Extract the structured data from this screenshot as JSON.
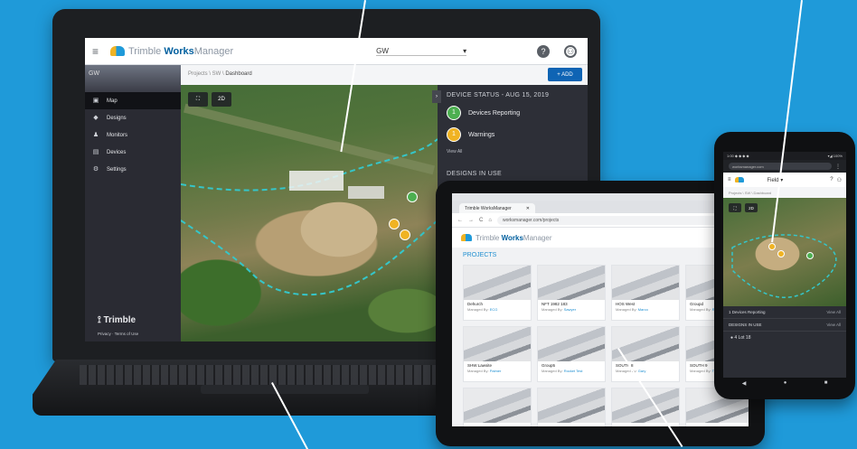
{
  "laptop": {
    "topbar": {
      "logo_prefix": "Trimble ",
      "logo_bold": "Works",
      "logo_suffix": "Manager",
      "site_select": "GW",
      "select_caret": "▾",
      "help_icon": "?",
      "user_icon": "⚇"
    },
    "subbar": {
      "prefix": "Projects \\ SW \\ ",
      "current": "Dashboard",
      "add_button": "+ ADD"
    },
    "sidebar": {
      "site": "GW",
      "items": [
        {
          "icon": "▣",
          "label": "Map",
          "active": true
        },
        {
          "icon": "◆",
          "label": "Designs"
        },
        {
          "icon": "♟",
          "label": "Monitors"
        },
        {
          "icon": "▤",
          "label": "Devices"
        },
        {
          "icon": "⚙",
          "label": "Settings"
        }
      ],
      "brand": "⟟ Trimble",
      "legal": "Privacy · Terms of Use"
    },
    "map": {
      "fit_icon": "⛶",
      "mode_2d": "2D",
      "markers": [
        {
          "color": "#4caf50"
        },
        {
          "color": "#f0b323"
        },
        {
          "color": "#f0b323"
        }
      ]
    },
    "panel": {
      "collapse_icon": "›",
      "heading": "DEVICE STATUS - AUG 15, 2019",
      "reporting_count": "1",
      "reporting_label": "Devices Reporting",
      "reporting_color": "#4caf50",
      "warnings_count": "1",
      "warnings_label": "Warnings",
      "warnings_color": "#f0b323",
      "view_all": "View All",
      "designs_heading": "DESIGNS IN USE"
    }
  },
  "tablet": {
    "tab_title": "Trimble WorksManager",
    "tab_close": "✕",
    "nav_back": "←",
    "nav_forward": "→",
    "reload": "C",
    "home": "⌂",
    "url": "worksmanager.com/projects",
    "logo_prefix": "Trimble ",
    "logo_bold": "Works",
    "logo_suffix": "Manager",
    "projects_heading": "PROJECTS",
    "projects_menu": "≡",
    "cards": [
      {
        "name": "Dehurch",
        "by_prefix": "Managed By: ",
        "by": "ECG"
      },
      {
        "name": "NFT 1982 183",
        "by_prefix": "Managed By: ",
        "by": "Sawyer"
      },
      {
        "name": "HOS West",
        "by_prefix": "Managed By: ",
        "by": "Marco"
      },
      {
        "name": "Groupd",
        "by_prefix": "Managed By: ",
        "by": "Rob"
      },
      {
        "name": "SHW Lawsite",
        "by_prefix": "Managed By: ",
        "by": "Palmer"
      },
      {
        "name": "Group5",
        "by_prefix": "Managed By: ",
        "by": "Rocket Test"
      },
      {
        "name": "SOUTH 8",
        "by_prefix": "Managed By: ",
        "by": "Gary"
      },
      {
        "name": "SOUTH 9",
        "by_prefix": "Managed By: ",
        "by": "Tim"
      },
      {
        "name": "",
        "by_prefix": "",
        "by": ""
      },
      {
        "name": "",
        "by_prefix": "",
        "by": ""
      },
      {
        "name": "",
        "by_prefix": "",
        "by": ""
      },
      {
        "name": "",
        "by_prefix": "",
        "by": ""
      }
    ]
  },
  "phone": {
    "status_left": "1:00 ◆ ◆ ◆ ◆",
    "status_right": "▾◢ 100%",
    "url": "worksmanager.com",
    "url_menu": "⋮",
    "menu_icon": "≡",
    "site": "Field",
    "site_caret": "▾",
    "help_icon": "?",
    "user_icon": "⚇",
    "breadcrumb": "Projects \\ SW \\ Dashboard",
    "fit_icon": "⛶",
    "mode_2d": "2D",
    "rows": [
      {
        "label": "1 Devices Reporting",
        "value": "View All"
      },
      {
        "label": "DESIGNS IN USE",
        "value": "View All"
      }
    ],
    "design_item": "● 4 Lot 18",
    "nav_back": "◀",
    "nav_home": "●",
    "nav_recent": "■"
  }
}
